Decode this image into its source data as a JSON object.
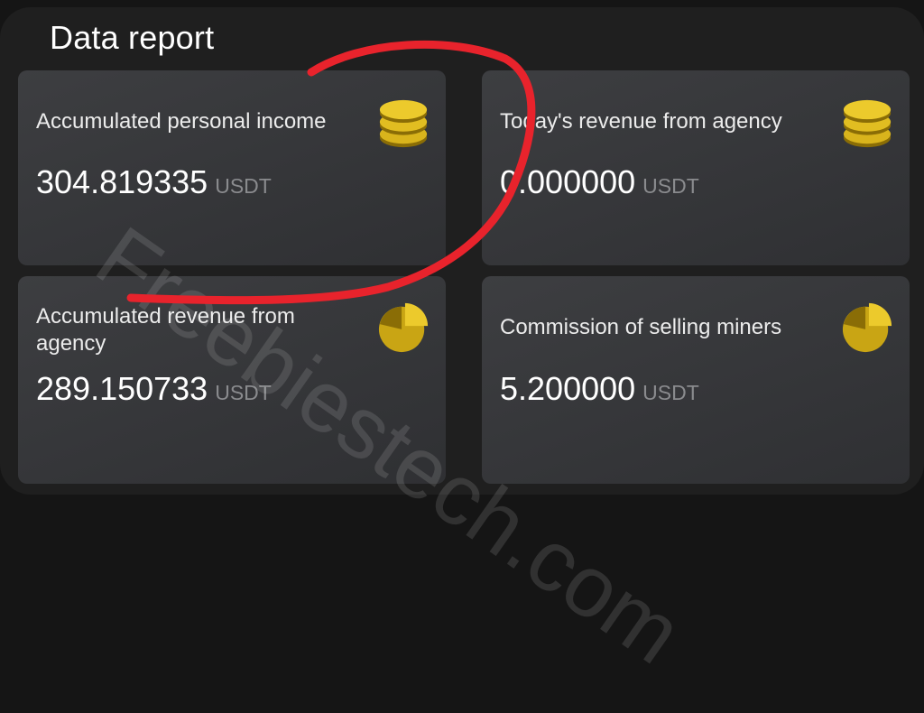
{
  "report": {
    "title": "Data report"
  },
  "cards": [
    {
      "label": "Accumulated personal income",
      "value": "304.819335",
      "unit": "USDT",
      "icon": "coins-stack-icon"
    },
    {
      "label": "Today's revenue from agency",
      "value": "0.000000",
      "unit": "USDT",
      "icon": "coins-stack-icon"
    },
    {
      "label": "Accumulated revenue from agency",
      "value": "289.150733",
      "unit": "USDT",
      "icon": "pie-chart-icon"
    },
    {
      "label": "Commission of selling miners",
      "value": "5.200000",
      "unit": "USDT",
      "icon": "pie-chart-icon"
    }
  ],
  "watermark": {
    "text": "Freebiestech.com"
  },
  "colors": {
    "accent_gold": "#d9b41c",
    "scribble_red": "#e8232c",
    "card_bg": "#36373a"
  }
}
